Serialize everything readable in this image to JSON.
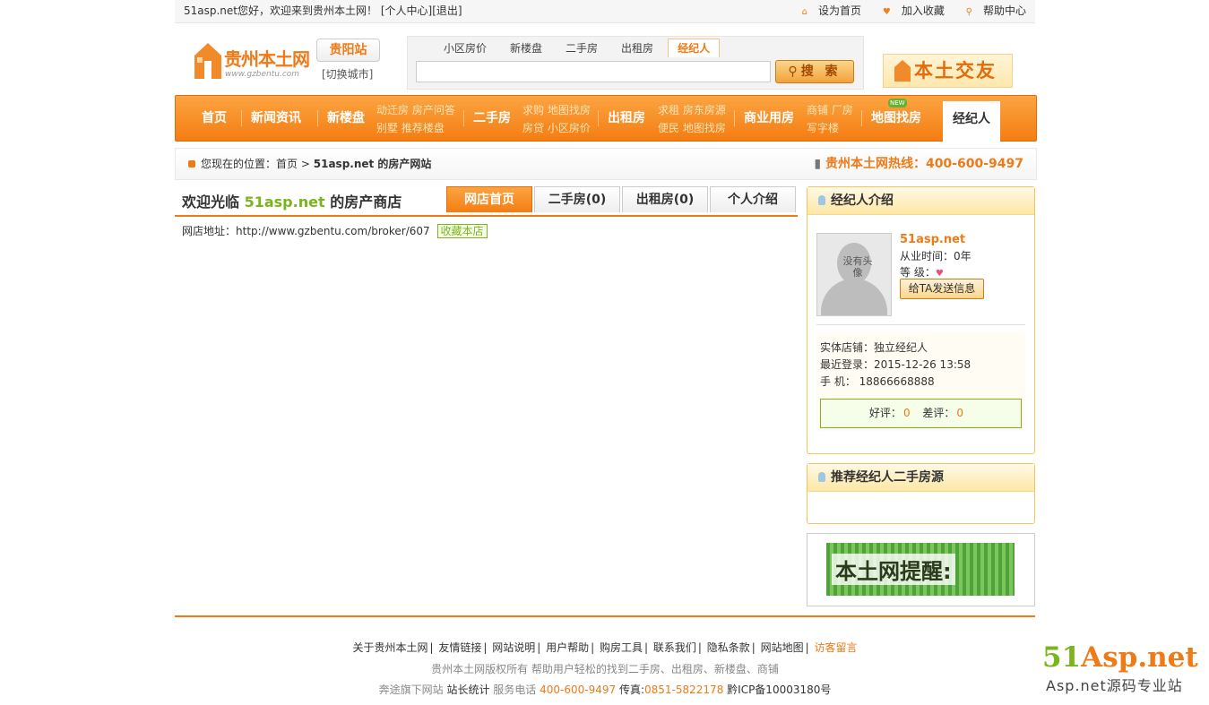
{
  "topbar": {
    "greeting": "51asp.net您好，欢迎来到贵州本土网！",
    "links": [
      "[个人中心]",
      "[退出]"
    ],
    "right": [
      "设为首页",
      "加入收藏",
      "帮助中心"
    ]
  },
  "header": {
    "logo_name": "贵州本土网",
    "logo_url": "www.gzbentu.com",
    "city": "贵阳站",
    "switch_city": "[切换城市]",
    "search_tabs": [
      "小区房价",
      "新楼盘",
      "二手房",
      "出租房",
      "经纪人"
    ],
    "search_button": "搜 索",
    "friend_banner": "本土交友"
  },
  "nav": {
    "home": "首页",
    "news": "新闻资讯",
    "newhouse": "新楼盘",
    "newhouse_sub": [
      "动迁房 房产问答",
      "别墅 推荐楼盘"
    ],
    "secondhand": "二手房",
    "secondhand_sub": [
      "求购 地图找房",
      "房贷 小区房价"
    ],
    "rent": "出租房",
    "rent_sub": [
      "求租 房东房源",
      "便民 地图找房"
    ],
    "commercial": "商业用房",
    "commercial_sub": [
      "商铺 厂房",
      "写字楼"
    ],
    "map": "地图找房",
    "new_badge": "NEW",
    "broker": "经纪人"
  },
  "breadcrumb": {
    "prefix": "您现在的位置：",
    "home": "首页",
    "sep": ">",
    "current": "51asp.net 的房产网站",
    "hotline": "贵州本土网热线：400-600-9497"
  },
  "shop": {
    "title_prefix": "欢迎光临",
    "name": "51asp.net",
    "title_suffix": "的房产商店",
    "tabs": [
      "网店首页",
      "二手房(0)",
      "出租房(0)",
      "个人介绍"
    ],
    "address_label": "网店地址：",
    "address": "http://www.gzbentu.com/broker/607",
    "collect": "收藏本店"
  },
  "broker": {
    "panel_title": "经纪人介绍",
    "avatar_text": "没有头像",
    "name": "51asp.net",
    "years": "从业时间：0年",
    "level_label": "等 级：",
    "send_button": "给TA发送信息",
    "store": "实体店铺：独立经纪人",
    "last_login": "最近登录：2015-12-26 13:58",
    "phone": "手 机： 18866668888",
    "good_label": "好评：",
    "good": "0",
    "bad_label": "差评：",
    "bad": "0"
  },
  "recommend": {
    "title": "推荐经纪人二手房源"
  },
  "notice": {
    "text": "本土网提醒:"
  },
  "footer": {
    "links": [
      "关于贵州本土网",
      "友情链接",
      "网站说明",
      "用户帮助",
      "购房工具",
      "联系我们",
      "隐私条款",
      "网站地图"
    ],
    "message": "访客留言",
    "copyright": "贵州本土网版权所有 帮助用户轻松的找到二手房、出租房、新楼盘、商铺",
    "info_a": "奔途旗下网站",
    "info_b": "站长统计",
    "info_c": "服务电话",
    "phone": "400-600-9497",
    "fax_label": "传真:",
    "fax": "0851-5822178",
    "icp": "黔ICP备10003180号"
  },
  "watermark": {
    "main_a": "51",
    "main_b": "Asp.net",
    "sub": "Asp.net源码专业站"
  },
  "colors": {
    "accent": "#ef7a18",
    "green": "#7bb51e",
    "panel_border": "#f3c55d"
  }
}
